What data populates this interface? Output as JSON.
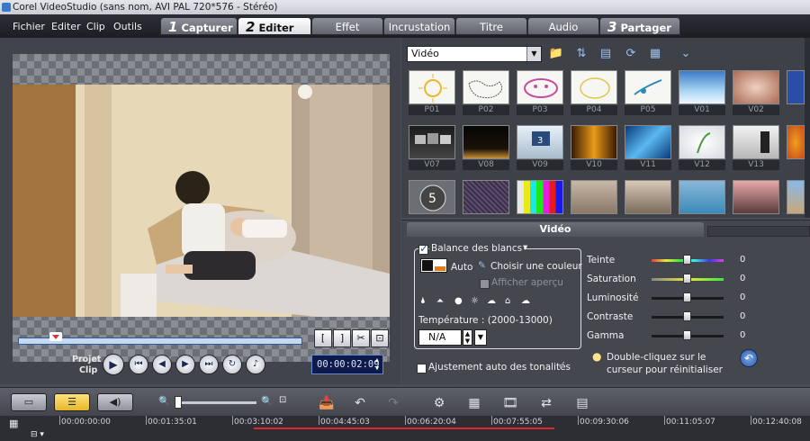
{
  "window": {
    "title": "Corel VideoStudio (sans nom, AVI PAL 720*576 - Stéréo)"
  },
  "menu": [
    "Fichier",
    "Editer",
    "Clip",
    "Outils"
  ],
  "steps": [
    {
      "num": "1",
      "label": "Capturer"
    },
    {
      "num": "2",
      "label": "Editer"
    },
    {
      "num": "3",
      "label": "Partager"
    }
  ],
  "tabs": [
    "Effet",
    "Incrustation",
    "Titre",
    "Audio"
  ],
  "player": {
    "projet_label": "Projet",
    "clip_label": "Clip",
    "timecode": "00:00:02:09",
    "mark_in": "[",
    "mark_out": "]"
  },
  "library": {
    "category": "Vidéo",
    "thumbnails": [
      "P01",
      "P02",
      "P03",
      "P04",
      "P05",
      "V01",
      "V02",
      "V07",
      "V08",
      "V09",
      "V10",
      "V11",
      "V12",
      "V13"
    ]
  },
  "options": {
    "tab_label": "Vidéo",
    "white_balance": "Balance des blancs",
    "auto": "Auto",
    "choose_color": "Choisir une couleur",
    "show_preview": "Afficher aperçu",
    "temperature_label": "Température : (2000-13000)",
    "temperature_value": "N/A",
    "auto_tone": "Ajustement auto des tonalités",
    "hint_line1": "Double-cliquez sur le",
    "hint_line2": "curseur pour réinitialiser",
    "sliders": [
      {
        "name": "Teinte",
        "value": "0"
      },
      {
        "name": "Saturation",
        "value": "0"
      },
      {
        "name": "Luminosité",
        "value": "0"
      },
      {
        "name": "Contraste",
        "value": "0"
      },
      {
        "name": "Gamma",
        "value": "0"
      }
    ]
  },
  "timeline": {
    "ruler": [
      "00:00:00:00",
      "00:01:35:01",
      "00:03:10:02",
      "00:04:45:03",
      "00:06:20:04",
      "00:07:55:05",
      "00:09:30:06",
      "00:11:05:07",
      "00:12:40:08"
    ]
  }
}
